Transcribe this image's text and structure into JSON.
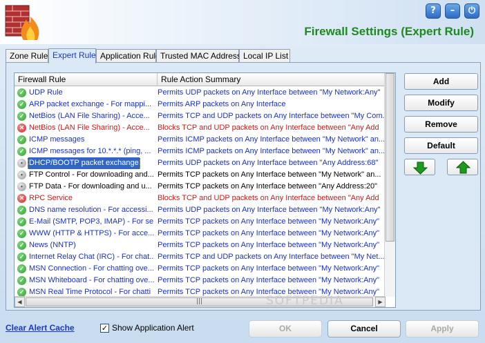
{
  "window": {
    "title": "Firewall Settings (Expert Rule)",
    "buttons": {
      "help": "?",
      "minimize": "–",
      "power": "⏻"
    }
  },
  "tabs": [
    {
      "label": "Zone Rule",
      "active": false
    },
    {
      "label": "Expert Rule",
      "active": true
    },
    {
      "label": "Application Rule",
      "active": false
    },
    {
      "label": "Trusted MAC Address",
      "active": false
    },
    {
      "label": "Local IP List",
      "active": false
    }
  ],
  "grid": {
    "columns": [
      "Firewall Rule",
      "Rule Action Summary"
    ],
    "rows": [
      {
        "rule": "UDP Rule",
        "summary": "Permits UDP packets on Any Interface between \"My Network:Any\" ",
        "status": "permit",
        "color": "#1a2fd0"
      },
      {
        "rule": "ARP packet exchange - For mappi...",
        "summary": "Permits ARP packets on Any Interface",
        "status": "permit",
        "color": "#1a2fd0"
      },
      {
        "rule": "NetBios (LAN File Sharing) - Acce...",
        "summary": "Permits TCP and UDP packets on Any Interface between \"My Com...",
        "status": "permit",
        "color": "#1a2fd0"
      },
      {
        "rule": "NetBios (LAN File Sharing) - Acce...",
        "summary": "Blocks TCP and UDP packets on Any Interface between \"Any Add",
        "status": "block",
        "color": "#d01818"
      },
      {
        "rule": "ICMP messages",
        "summary": "Permits ICMP packets on Any Interface between \"My Network\" an...",
        "status": "permit",
        "color": "#1a2fd0"
      },
      {
        "rule": "ICMP messages  for  10.*.*.* (ping, ...",
        "summary": "Permits ICMP packets on Any Interface between \"My Network\" an...",
        "status": "permit",
        "color": "#1a2fd0"
      },
      {
        "rule": "DHCP/BOOTP packet exchange",
        "summary": "Permits UDP packets on Any Interface between \"Any Address:68\"",
        "status": "neutral",
        "color": "#1a2fd0",
        "selected": true
      },
      {
        "rule": "FTP Control - For downloading and...",
        "summary": "Permits TCP packets on Any Interface between \"My Network\" an...",
        "status": "neutral",
        "color": "#000000"
      },
      {
        "rule": "FTP Data - For downloading and u...",
        "summary": "Permits TCP packets on Any Interface between \"Any Address:20\"",
        "status": "neutral",
        "color": "#000000"
      },
      {
        "rule": "RPC Service",
        "summary": "Blocks TCP and UDP packets on Any Interface between \"Any Add",
        "status": "block",
        "color": "#d01818"
      },
      {
        "rule": "DNS name resolution - For accessi...",
        "summary": "Permits UDP packets on Any Interface between \"My Network:Any\"",
        "status": "permit",
        "color": "#1a2fd0"
      },
      {
        "rule": "E-Mail (SMTP, POP3, IMAP) - For se...",
        "summary": "Permits TCP packets on Any Interface between \"My Network:Any\"",
        "status": "permit",
        "color": "#1a2fd0"
      },
      {
        "rule": "WWW (HTTP & HTTPS) - For acce...",
        "summary": "Permits TCP packets on Any Interface between \"My Network:Any\"",
        "status": "permit",
        "color": "#1a2fd0"
      },
      {
        "rule": "News (NNTP)",
        "summary": "Permits TCP packets on Any Interface between \"My Network:Any\"",
        "status": "permit",
        "color": "#1a2fd0"
      },
      {
        "rule": "Internet Relay Chat (IRC) - For chat...",
        "summary": "Permits TCP and UDP packets on Any Interface between \"My Net...",
        "status": "permit",
        "color": "#1a2fd0"
      },
      {
        "rule": "MSN Connection - For chatting ove...",
        "summary": "Permits TCP packets on Any Interface between \"My Network:Any\"",
        "status": "permit",
        "color": "#1a2fd0"
      },
      {
        "rule": "MSN Whiteboard - For chatting ove...",
        "summary": "Permits TCP packets on Any Interface between \"My Network:Any\"",
        "status": "permit",
        "color": "#1a2fd0"
      },
      {
        "rule": "MSN Real Time Protocol - For chatti",
        "summary": "Permits TCP packets on Any Interface between \"My Network:Any\"",
        "status": "permit",
        "color": "#1a2fd0"
      }
    ]
  },
  "side_buttons": {
    "add": "Add",
    "modify": "Modify",
    "remove": "Remove",
    "default": "Default"
  },
  "footer": {
    "clear_alert": "Clear Alert Cache",
    "show_alert_label": "Show Application Alert",
    "show_alert_checked": "✓",
    "ok": "OK",
    "cancel": "Cancel",
    "apply": "Apply"
  },
  "watermark": "SOFTPEDIA",
  "colors": {
    "permit": "#2fa52f",
    "block": "#d52a2a",
    "neutral": "#9a9a9a",
    "title": "#1d8a1d"
  }
}
